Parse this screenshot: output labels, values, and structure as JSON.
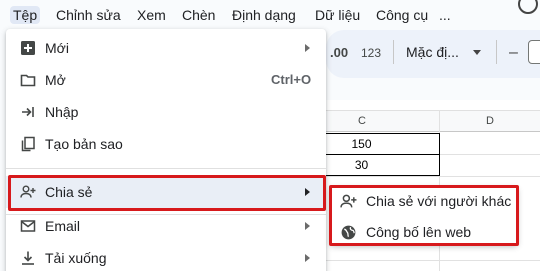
{
  "menubar": {
    "items": [
      {
        "label": "Tệp"
      },
      {
        "label": "Chỉnh sửa"
      },
      {
        "label": "Xem"
      },
      {
        "label": "Chèn"
      },
      {
        "label": "Định dạng"
      },
      {
        "label": "Dữ liệu"
      },
      {
        "label": "Công cụ"
      },
      {
        "label": "..."
      }
    ]
  },
  "toolbar": {
    "decimal_increase": ".00",
    "number_format": "123",
    "font_name": "Mặc đị...",
    "font_size_decrease": "–"
  },
  "sheet": {
    "columns": [
      "C",
      "D"
    ],
    "cells": [
      "150",
      "30"
    ]
  },
  "file_menu": {
    "items": [
      {
        "label": "Mới",
        "icon": "plus-box-icon",
        "has_submenu": true
      },
      {
        "label": "Mở",
        "icon": "folder-icon",
        "shortcut": "Ctrl+O"
      },
      {
        "label": "Nhập",
        "icon": "import-arrow-icon"
      },
      {
        "label": "Tạo bản sao",
        "icon": "copy-icon"
      },
      {
        "label": "Chia sẻ",
        "icon": "person-add-icon",
        "has_submenu": true,
        "highlighted": true
      },
      {
        "label": "Email",
        "icon": "email-icon",
        "has_submenu": true
      },
      {
        "label": "Tải xuống",
        "icon": "download-icon",
        "has_submenu": true
      }
    ]
  },
  "share_submenu": {
    "items": [
      {
        "label": "Chia sẻ với người khác",
        "icon": "person-add-icon"
      },
      {
        "label": "Công bố lên web",
        "icon": "globe-icon"
      }
    ]
  },
  "colors": {
    "highlight_border": "#d7191c",
    "menu_highlight": "#e9eef6",
    "active_menu": "#e1e8f5"
  }
}
